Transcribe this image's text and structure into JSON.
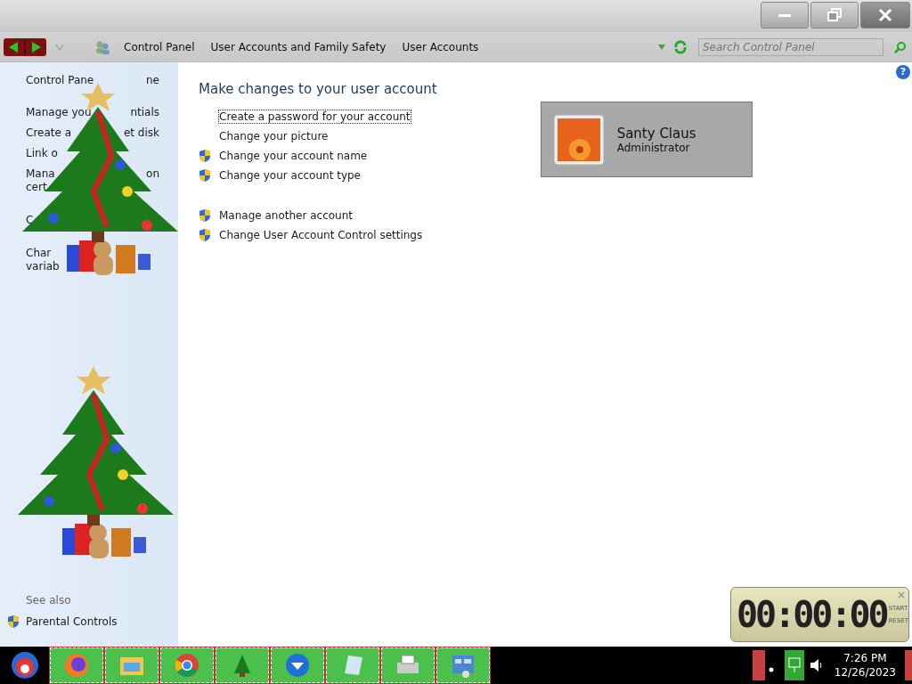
{
  "address_bar": {
    "breadcrumbs": [
      "Control Panel",
      "User Accounts and Family Safety",
      "User Accounts"
    ]
  },
  "search": {
    "placeholder": "Search Control Panel"
  },
  "help": {
    "label": "?"
  },
  "sidebar": {
    "links": [
      {
        "kind": "home",
        "left": "Control Pane",
        "right": "ne"
      },
      {
        "kind": "link",
        "left": "Manage you",
        "right": "ntials"
      },
      {
        "kind": "link",
        "left": "Create a",
        "right": "et disk"
      },
      {
        "kind": "link",
        "left": "Link o"
      },
      {
        "kind": "link",
        "left": "Mana",
        "right": "on"
      },
      {
        "kind": "wrap",
        "left": "cert"
      },
      {
        "kind": "gap",
        "left": "C"
      },
      {
        "kind": "gap",
        "left": "Char"
      },
      {
        "kind": "wrap",
        "left": "variab"
      }
    ],
    "see_also_title": "See also",
    "see_also": [
      {
        "label": "Parental Controls",
        "shield": true
      }
    ]
  },
  "main": {
    "heading": "Make changes to your user account",
    "tasks": [
      {
        "label": "Create a password for your account",
        "shield": false,
        "focused": true
      },
      {
        "label": "Change your picture",
        "shield": false,
        "focused": false
      },
      {
        "label": "Change your account name",
        "shield": true,
        "focused": false
      },
      {
        "label": "Change your account type",
        "shield": true,
        "focused": false
      }
    ],
    "more_tasks": [
      {
        "label": "Manage another account",
        "shield": true,
        "focused": false
      },
      {
        "label": "Change User Account Control settings",
        "shield": true,
        "focused": false
      }
    ]
  },
  "account": {
    "name": "Santy Claus",
    "role": "Administrator"
  },
  "timer": {
    "time": "00:00:00",
    "buttons": [
      "START",
      "RESET"
    ]
  },
  "taskbar": {
    "apps": [
      {
        "kind": "firefox"
      },
      {
        "kind": "folder"
      },
      {
        "kind": "chrome"
      },
      {
        "kind": "tree"
      },
      {
        "kind": "mail"
      },
      {
        "kind": "notepad"
      },
      {
        "kind": "printer"
      },
      {
        "kind": "panel"
      }
    ]
  },
  "clock": {
    "time": "7:26 PM",
    "date": "12/26/2023"
  }
}
